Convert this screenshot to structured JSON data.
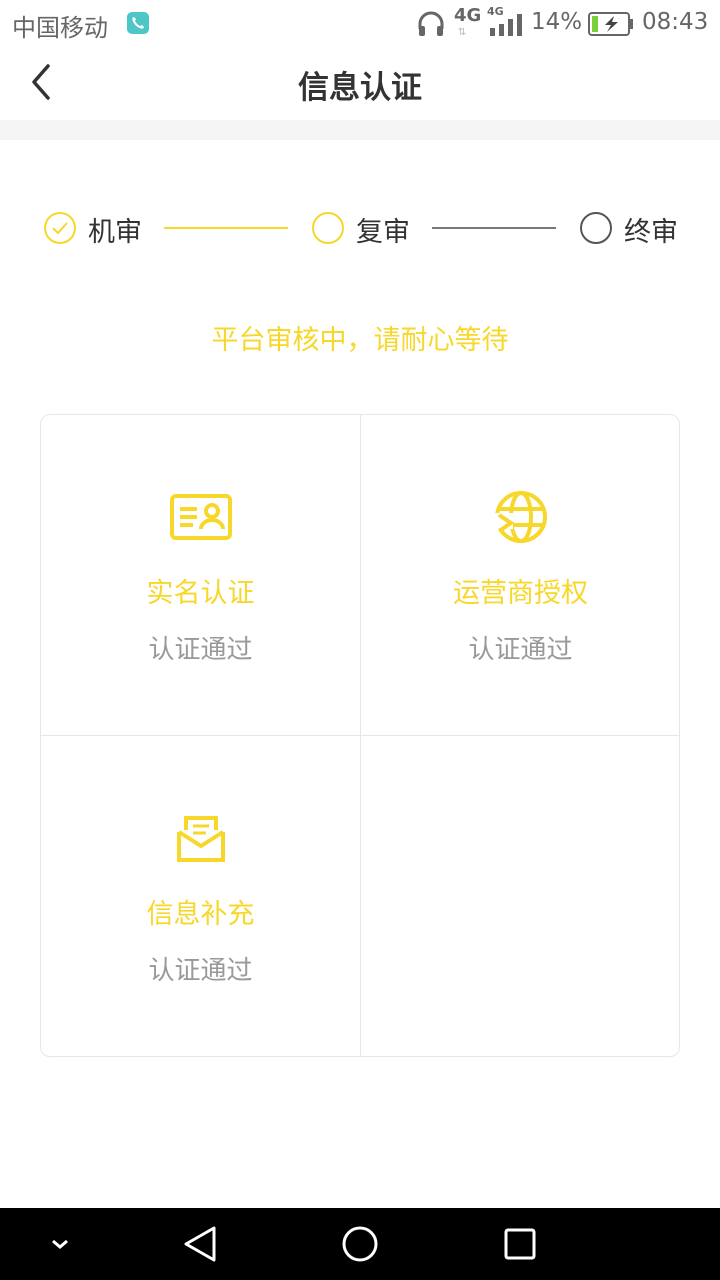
{
  "status_bar": {
    "carrier": "中国移动",
    "network_1": "4G",
    "network_2": "4G",
    "battery": "14%",
    "time": "08:43"
  },
  "header": {
    "title": "信息认证",
    "back_icon": "chevron-left-icon"
  },
  "steps": [
    {
      "label": "机审",
      "state": "done"
    },
    {
      "label": "复审",
      "state": "current"
    },
    {
      "label": "终审",
      "state": "pending"
    }
  ],
  "review_status": "平台审核中，请耐心等待",
  "cards": [
    {
      "title": "实名认证",
      "status": "认证通过",
      "icon": "id-card-icon"
    },
    {
      "title": "运营商授权",
      "status": "认证通过",
      "icon": "globe-icon"
    },
    {
      "title": "信息补充",
      "status": "认证通过",
      "icon": "envelope-icon"
    }
  ],
  "colors": {
    "accent": "#f7d72a",
    "muted": "#999999",
    "text": "#333333"
  }
}
